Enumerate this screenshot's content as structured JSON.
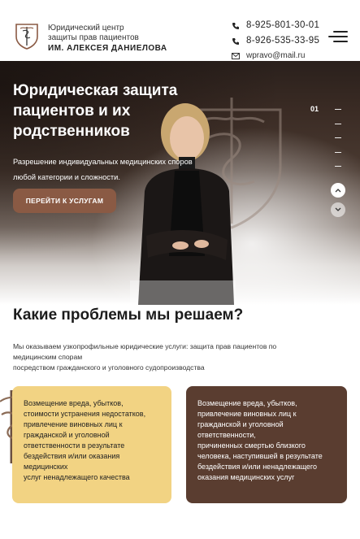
{
  "header": {
    "logo_line1": "Юридический центр",
    "logo_line2": "защиты прав пациентов",
    "logo_name": "ИМ. АЛЕКСЕЯ ДАНИЕЛОВА",
    "phone1": "8-925-801-30-01",
    "phone2": "8-926-535-33-95",
    "email": "wpravo@mail.ru"
  },
  "hero": {
    "title_line1": "Юридическая защита",
    "title_line2": "пациентов и их",
    "title_line3": "родственников",
    "sub_line1": "Разрешение индивидуальных медицинских споров",
    "sub_line2": "любой категории и сложности.",
    "button_label": "ПЕРЕЙТИ К УСЛУГАМ",
    "slide_number": "01"
  },
  "problems": {
    "title": "Какие проблемы мы решаем?",
    "intro_line1": "Мы оказываем узкопрофильные юридические услуги: защита прав пациентов по",
    "intro_line2": "медицинским спорам",
    "intro_line3": "посредством гражданского и уголовного судопроизводства",
    "card1_lines": [
      "Возмещение вреда, убытков,",
      "стоимости устранения недостатков,",
      "привлечение виновных лиц к",
      "гражданской и уголовной",
      "ответственности в результате",
      "бездействия и/или оказания",
      "медицинских",
      "услуг ненадлежащего качества"
    ],
    "card2_lines": [
      "Возмещение вреда, убытков,",
      "привлечение виновных лиц к",
      "гражданской и уголовной",
      "ответственности,",
      "причиненных смертью близкого",
      "человека, наступившей в результате",
      "бездействия и/или ненадлежащего",
      "оказания медицинских услуг"
    ]
  },
  "colors": {
    "accent_button": "#8a5a44",
    "card_yellow": "#f2d383",
    "card_brown": "#5a3d30"
  },
  "icons": [
    "logo-emblem-icon",
    "phone-icon",
    "mail-icon",
    "menu-icon",
    "chevron-up-icon",
    "chevron-down-icon"
  ]
}
